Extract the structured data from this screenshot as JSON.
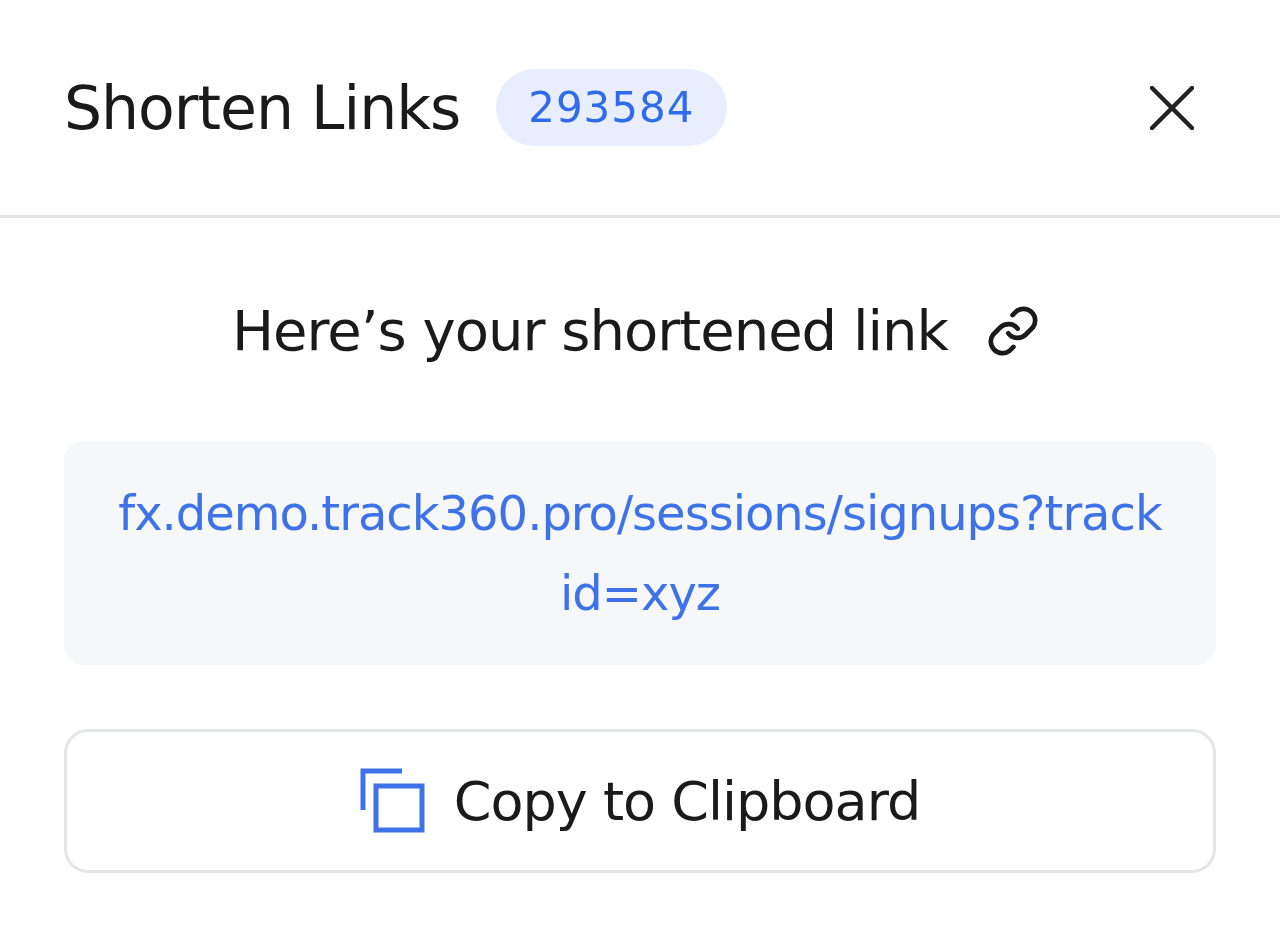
{
  "header": {
    "title": "Shorten Links",
    "badge": "293584"
  },
  "message": "Here’s your shortened link",
  "short_link": "fx.demo.track360.pro/sessions/signups?trackid=xyz",
  "buttons": [
    {
      "label": "Copy to Clipboard",
      "kind": "copy"
    }
  ]
}
